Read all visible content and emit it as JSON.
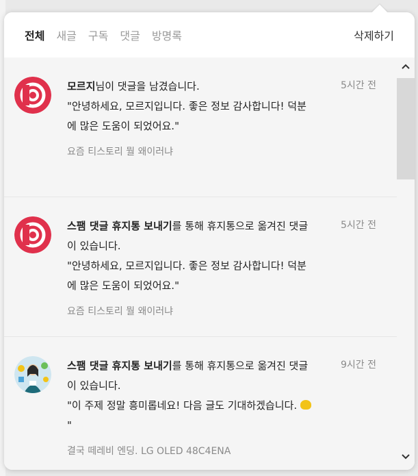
{
  "header": {
    "tabs": [
      "전체",
      "새글",
      "구독",
      "댓글",
      "방명록"
    ],
    "delete_all": "삭제하기"
  },
  "notifications": [
    {
      "actor": "모르지",
      "action": "님이 댓글을 남겼습니다.",
      "quote": "\"안녕하세요, 모르지입니다. 좋은 정보 감사합니다! 덕분에 많은 도움이 되었어요.\"",
      "source": "요즘 티스토리 뭘 왜이러냐",
      "time": "5시간 전",
      "avatar": "red-target-avatar"
    },
    {
      "actor": "스팸 댓글 휴지통 보내기",
      "action": "를 통해 휴지통으로 옮겨진 댓글이 있습니다.",
      "quote": "\"안녕하세요, 모르지입니다. 좋은 정보 감사합니다! 덕분에 많은 도움이 되었어요.\"",
      "source": "요즘 티스토리 뭘 왜이러냐",
      "time": "5시간 전",
      "avatar": "red-target-avatar"
    },
    {
      "actor": "스팸 댓글 휴지통 보내기",
      "action": "를 통해 휴지통으로 옮겨진 댓글이 있습니다.",
      "quote_text": "\"이 주제 정말 흥미롭네요! 다음 글도 기대하겠습니다. ",
      "quote_emoji": "clapping-hands-emoji",
      "quote_end": "\"",
      "source": "결국 떼레비 엔딩. LG OLED 48C4ENA",
      "time": "9시간 전",
      "avatar": "person-illustration-avatar"
    }
  ],
  "colors": {
    "accent": "#e0314c",
    "muted": "#8a8a8a"
  }
}
